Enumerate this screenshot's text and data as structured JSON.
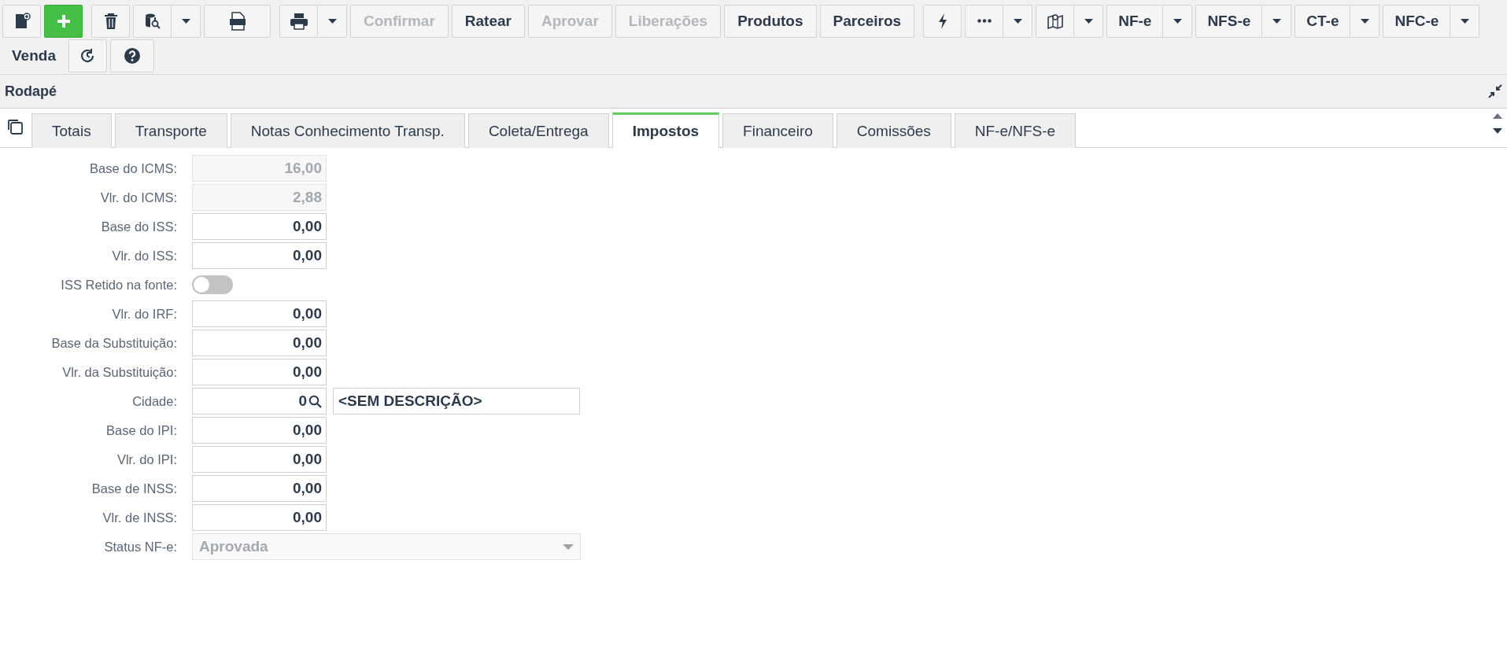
{
  "toolbar": {
    "text_buttons": [
      {
        "label": "Confirmar",
        "disabled": true
      },
      {
        "label": "Ratear",
        "disabled": false
      },
      {
        "label": "Aprovar",
        "disabled": true
      },
      {
        "label": "Liberações",
        "disabled": true
      },
      {
        "label": "Produtos",
        "disabled": false
      },
      {
        "label": "Parceiros",
        "disabled": false
      }
    ],
    "document_buttons": [
      "NF-e",
      "NFS-e",
      "CT-e",
      "NFC-e"
    ],
    "second_row_label": "Venda"
  },
  "panel": {
    "title": "Rodapé"
  },
  "tabs": [
    {
      "label": "Totais",
      "selected": false
    },
    {
      "label": "Transporte",
      "selected": false
    },
    {
      "label": "Notas Conhecimento Transp.",
      "selected": false
    },
    {
      "label": "Coleta/Entrega",
      "selected": false
    },
    {
      "label": "Impostos",
      "selected": true
    },
    {
      "label": "Financeiro",
      "selected": false
    },
    {
      "label": "Comissões",
      "selected": false
    },
    {
      "label": "NF-e/NFS-e",
      "selected": false
    }
  ],
  "fields": [
    {
      "kind": "number",
      "label": "Base do ICMS:",
      "value": "16,00",
      "disabled": true
    },
    {
      "kind": "number",
      "label": "Vlr. do ICMS:",
      "value": "2,88",
      "disabled": true
    },
    {
      "kind": "number",
      "label": "Base do ISS:",
      "value": "0,00",
      "disabled": false
    },
    {
      "kind": "number",
      "label": "Vlr. do ISS:",
      "value": "0,00",
      "disabled": false
    },
    {
      "kind": "toggle",
      "label": "ISS Retido na fonte:",
      "on": false
    },
    {
      "kind": "number",
      "label": "Vlr. do IRF:",
      "value": "0,00",
      "disabled": false
    },
    {
      "kind": "number",
      "label": "Base da Substituição:",
      "value": "0,00",
      "disabled": false
    },
    {
      "kind": "number",
      "label": "Vlr. da Substituição:",
      "value": "0,00",
      "disabled": false
    },
    {
      "kind": "lookup",
      "label": "Cidade:",
      "value": "0",
      "description": "<SEM DESCRIÇÃO>"
    },
    {
      "kind": "number",
      "label": "Base do IPI:",
      "value": "0,00",
      "disabled": false
    },
    {
      "kind": "number",
      "label": "Vlr. do IPI:",
      "value": "0,00",
      "disabled": false
    },
    {
      "kind": "number",
      "label": "Base de INSS:",
      "value": "0,00",
      "disabled": false
    },
    {
      "kind": "number",
      "label": "Vlr. de INSS:",
      "value": "0,00",
      "disabled": false
    },
    {
      "kind": "select",
      "label": "Status NF-e:",
      "value": "Aprovada",
      "disabled": true
    }
  ]
}
